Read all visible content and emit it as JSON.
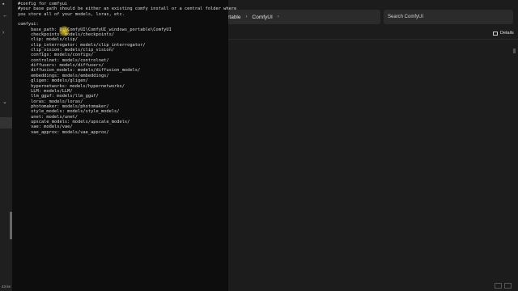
{
  "explorer": {
    "breadcrumbs": [
      "portable",
      "ComfyUI"
    ],
    "search_placeholder": "Search ComfyUI",
    "details_label": "Details",
    "status_text": "43 ite"
  },
  "editor": {
    "lines": [
      "#config for comfyui",
      "#your base path should be either an existing comfy install or a central folder where",
      "you store all of your models, loras, etc.",
      "",
      "comfyui:",
      "     base_path: D:\\ComfyUI\\ComfyUI_windows_portable\\ComfyUI",
      "     checkpoints: models/checkpoints/",
      "     clip: models/clip/",
      "     clip_interrogator: models/clip_interrogator/",
      "     clip_vision: models/clip_vision/",
      "     configs: models/configs/",
      "     controlnet: models/controlnet/",
      "     diffusers: models/diffusers/",
      "     diffusion_models: models/diffusion_models/",
      "     embeddings: models/embeddings/",
      "     gligen: models/gligen/",
      "     hypernetworks: models/hypernetworks/",
      "     LLM: models/LLM/",
      "     llm_gguf: models/llm_gguf/",
      "     loras: models/loras/",
      "     photomaker: models/photomaker/",
      "     style_models: models/style_models/",
      "     unet: models/unet/",
      "     upscale_models: models/upscale_models/",
      "     vae: models/vae/",
      "     vae_approx: models/vae_approx/"
    ]
  }
}
